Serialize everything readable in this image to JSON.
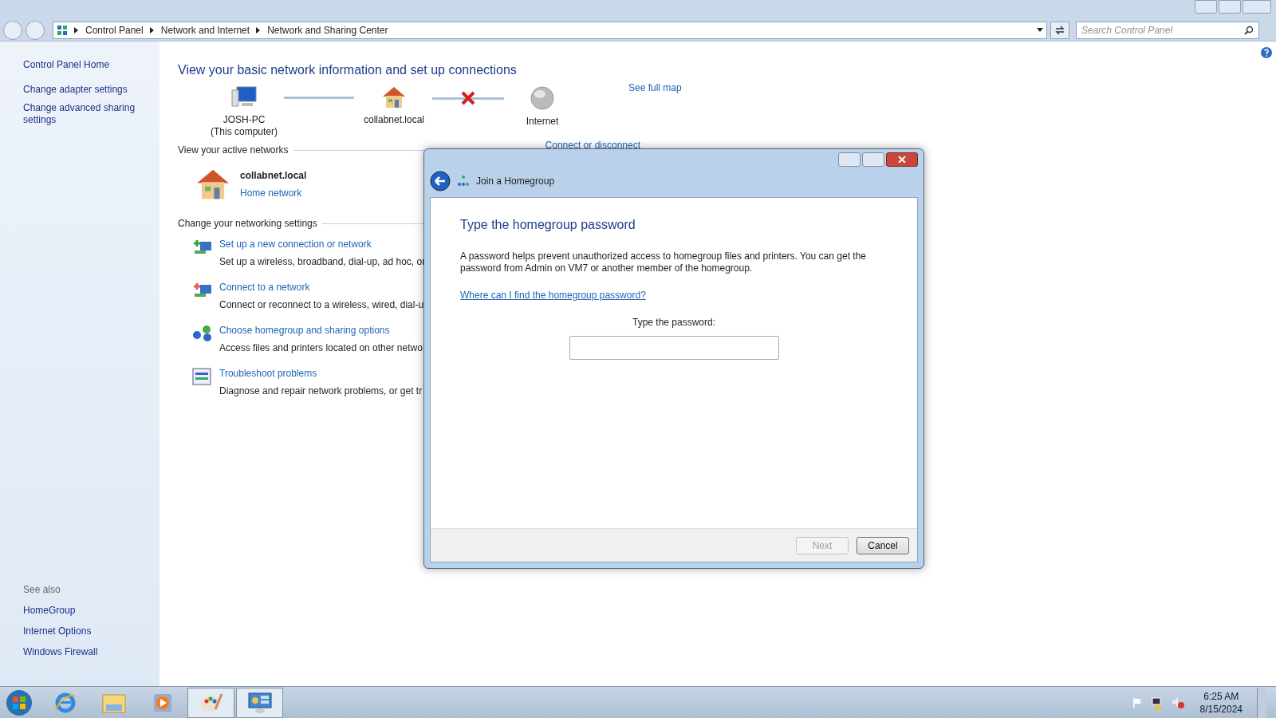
{
  "address_bar": {
    "breadcrumbs": [
      "Control Panel",
      "Network and Internet",
      "Network and Sharing Center"
    ],
    "search": {
      "placeholder": "Search Control Panel"
    }
  },
  "sidebar": {
    "items": [
      "Control Panel Home",
      "Change adapter settings",
      "Change advanced sharing settings"
    ],
    "see_also_title": "See also",
    "see_also": [
      "HomeGroup",
      "Internet Options",
      "Windows Firewall"
    ]
  },
  "main": {
    "title": "View your basic network information and set up connections",
    "see_full_map": "See full map",
    "map": [
      {
        "kind": "computer",
        "label": "JOSH-PC",
        "sublabel": "(This computer)",
        "broken_link_to_next": false
      },
      {
        "kind": "home",
        "label": "collabnet.local",
        "broken_link_to_next": true
      },
      {
        "kind": "globe",
        "label": "Internet"
      }
    ],
    "active_networks_title": "View your active networks",
    "connect_link": "Connect or disconnect",
    "active_network": {
      "name": "collabnet.local",
      "type": "Home network"
    },
    "settings_title": "Change your networking settings",
    "tasks": [
      {
        "kind": "new",
        "link": "Set up a new connection or network",
        "description": "Set up a wireless, broadband, dial-up, ad hoc, or"
      },
      {
        "kind": "connect",
        "link": "Connect to a network",
        "description": "Connect or reconnect to a wireless, wired, dial-u"
      },
      {
        "kind": "homegroup",
        "link": "Choose homegroup and sharing options",
        "description": "Access files and printers located on other netwo"
      },
      {
        "kind": "troubleshoot",
        "link": "Troubleshoot problems",
        "description": "Diagnose and repair network problems, or get tr"
      }
    ]
  },
  "dialog": {
    "title": "Join a Homegroup",
    "heading": "Type the homegroup password",
    "body": "A password helps prevent unauthorized access to homegroup files and printers. You can get the password from Admin on VM7 or another member of the homegroup.",
    "help_link": "Where can I find the homegroup password?",
    "field_label": "Type the password:",
    "buttons": [
      {
        "label": "Next",
        "disabled": true
      },
      {
        "label": "Cancel",
        "disabled": false
      }
    ]
  },
  "taskbar": {
    "apps": [
      {
        "kind": "ie",
        "selected": false
      },
      {
        "kind": "explorer",
        "selected": false
      },
      {
        "kind": "media",
        "selected": false
      },
      {
        "kind": "paint",
        "selected": true
      },
      {
        "kind": "controlpanel",
        "selected": true
      }
    ],
    "time": "6:25 AM",
    "date": "8/15/2024"
  }
}
